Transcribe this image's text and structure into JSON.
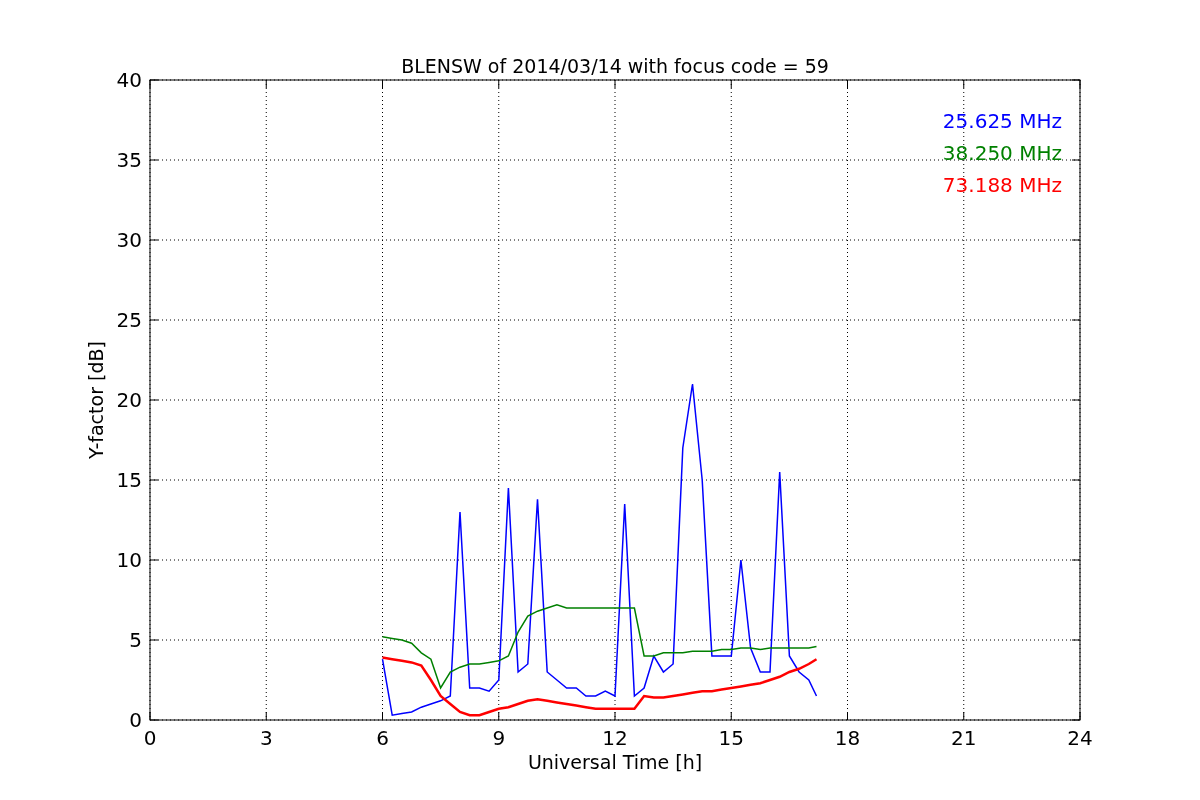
{
  "figure": {
    "chart_data": {
      "type": "line",
      "title": "BLENSW of 2014/03/14 with focus code = 59",
      "xlabel": "Universal Time [h]",
      "ylabel": "Y-factor [dB]",
      "x": [
        6,
        6.25,
        6.5,
        6.75,
        7,
        7.25,
        7.5,
        7.75,
        8,
        8.25,
        8.5,
        8.75,
        9,
        9.25,
        9.5,
        9.75,
        10,
        10.25,
        10.5,
        10.75,
        11,
        11.25,
        11.5,
        11.75,
        12,
        12.25,
        12.5,
        12.75,
        13,
        13.25,
        13.5,
        13.75,
        14,
        14.25,
        14.5,
        14.75,
        15,
        15.25,
        15.5,
        15.75,
        16,
        16.25,
        16.5,
        16.75,
        17,
        17.2
      ],
      "series": [
        {
          "name": "25.625 MHz",
          "color": "#0000ff",
          "values": [
            3.8,
            0.3,
            0.4,
            0.5,
            0.8,
            1.0,
            1.2,
            1.5,
            13,
            2,
            2,
            1.8,
            2.5,
            14.5,
            3,
            3.5,
            13.8,
            3,
            2.5,
            2,
            2,
            1.5,
            1.5,
            1.8,
            1.5,
            13.5,
            1.5,
            2,
            4,
            3,
            3.5,
            17,
            21,
            15,
            4,
            4,
            4,
            10,
            4.5,
            3,
            3,
            15.5,
            4,
            3,
            2.5,
            1.5
          ]
        },
        {
          "name": "38.250 MHz",
          "color": "#008000",
          "values": [
            5.2,
            5.1,
            5.0,
            4.8,
            4.2,
            3.8,
            2,
            3,
            3.3,
            3.5,
            3.5,
            3.6,
            3.7,
            4,
            5.5,
            6.5,
            6.8,
            7,
            7.2,
            7,
            7,
            7,
            7,
            7,
            7,
            7,
            7,
            4,
            4,
            4.2,
            4.2,
            4.2,
            4.3,
            4.3,
            4.3,
            4.4,
            4.4,
            4.5,
            4.5,
            4.4,
            4.5,
            4.5,
            4.5,
            4.5,
            4.5,
            4.6
          ]
        },
        {
          "name": "73.188 MHz",
          "color": "#ff0000",
          "values": [
            3.9,
            3.8,
            3.7,
            3.6,
            3.4,
            2.5,
            1.5,
            1.0,
            0.5,
            0.3,
            0.3,
            0.5,
            0.7,
            0.8,
            1,
            1.2,
            1.3,
            1.2,
            1.1,
            1,
            0.9,
            0.8,
            0.7,
            0.7,
            0.7,
            0.7,
            0.7,
            1.5,
            1.4,
            1.4,
            1.5,
            1.6,
            1.7,
            1.8,
            1.8,
            1.9,
            2,
            2.1,
            2.2,
            2.3,
            2.5,
            2.7,
            3,
            3.2,
            3.5,
            3.8
          ]
        }
      ],
      "grid": true,
      "xlim": [
        0,
        24
      ],
      "ylim": [
        0,
        40
      ],
      "xticks": [
        0,
        3,
        6,
        9,
        12,
        15,
        18,
        21,
        24
      ],
      "yticks": [
        0,
        5,
        10,
        15,
        20,
        25,
        30,
        35,
        40
      ]
    }
  }
}
